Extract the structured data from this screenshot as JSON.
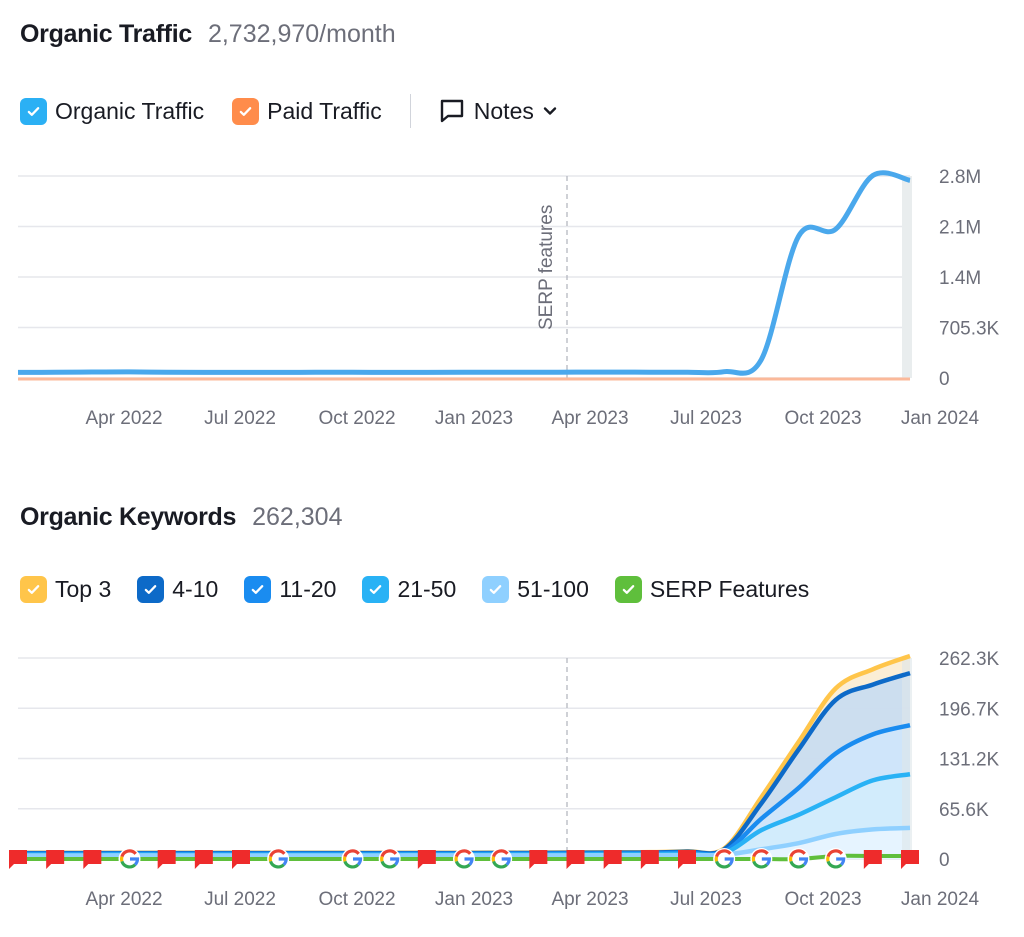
{
  "traffic": {
    "title": "Organic Traffic",
    "value": "2,732,970/month",
    "legend": [
      {
        "label": "Organic Traffic",
        "color": "#2bb0f4",
        "checked": true
      },
      {
        "label": "Paid Traffic",
        "color": "#ff8c4b",
        "checked": true
      }
    ],
    "notes_label": "Notes",
    "annotation": "SERP features"
  },
  "keywords": {
    "title": "Organic Keywords",
    "value": "262,304",
    "legend": [
      {
        "label": "Top 3",
        "color": "#ffc54a",
        "checked": true
      },
      {
        "label": "4-10",
        "color": "#0d6ac8",
        "checked": true
      },
      {
        "label": "11-20",
        "color": "#1a8cf0",
        "checked": true
      },
      {
        "label": "21-50",
        "color": "#29b2f5",
        "checked": true
      },
      {
        "label": "51-100",
        "color": "#8fd0ff",
        "checked": true
      },
      {
        "label": "SERP Features",
        "color": "#5fbf3c",
        "checked": true
      }
    ]
  },
  "chart_data": [
    {
      "type": "line",
      "title": "Organic Traffic",
      "x": [
        "Jan 2022",
        "Feb 2022",
        "Mar 2022",
        "Apr 2022",
        "May 2022",
        "Jun 2022",
        "Jul 2022",
        "Aug 2022",
        "Sep 2022",
        "Oct 2022",
        "Nov 2022",
        "Dec 2022",
        "Jan 2023",
        "Feb 2023",
        "Mar 2023",
        "Apr 2023",
        "May 2023",
        "Jun 2023",
        "Jul 2023",
        "Aug 2023",
        "Sep 2023",
        "Oct 2023",
        "Nov 2023",
        "Dec 2023"
      ],
      "x_tick_labels": [
        "Apr 2022",
        "Jul 2022",
        "Oct 2022",
        "Jan 2023",
        "Apr 2023",
        "Jul 2023",
        "Oct 2023",
        "Jan 2024"
      ],
      "y_tick_labels": [
        "0",
        "705.3K",
        "1.4M",
        "2.1M",
        "2.8M"
      ],
      "ylim": [
        0,
        2821200
      ],
      "grid": true,
      "annotations": [
        {
          "x": "Apr 2023",
          "label": "SERP features"
        }
      ],
      "series": [
        {
          "name": "Organic Traffic",
          "color": "#4aa8ec",
          "values": [
            50000,
            52000,
            55000,
            58000,
            52000,
            50000,
            51000,
            50000,
            52000,
            53000,
            50000,
            51000,
            52000,
            53000,
            52000,
            54000,
            54000,
            53000,
            52000,
            60000,
            230000,
            1950000,
            2050000,
            2800000,
            2732970
          ]
        },
        {
          "name": "Paid Traffic",
          "color": "#fbb99a",
          "values": [
            0,
            0,
            0,
            0,
            0,
            0,
            0,
            0,
            0,
            0,
            0,
            0,
            0,
            0,
            0,
            0,
            0,
            0,
            0,
            0,
            0,
            0,
            0,
            0,
            0
          ]
        }
      ]
    },
    {
      "type": "area",
      "title": "Organic Keywords",
      "x": [
        "Jan 2022",
        "Feb 2022",
        "Mar 2022",
        "Apr 2022",
        "May 2022",
        "Jun 2022",
        "Jul 2022",
        "Aug 2022",
        "Sep 2022",
        "Oct 2022",
        "Nov 2022",
        "Dec 2022",
        "Jan 2023",
        "Feb 2023",
        "Mar 2023",
        "Apr 2023",
        "May 2023",
        "Jun 2023",
        "Jul 2023",
        "Aug 2023",
        "Sep 2023",
        "Oct 2023",
        "Nov 2023",
        "Dec 2023"
      ],
      "x_tick_labels": [
        "Apr 2022",
        "Jul 2022",
        "Oct 2022",
        "Jan 2023",
        "Apr 2023",
        "Jul 2023",
        "Oct 2023",
        "Jan 2024"
      ],
      "y_tick_labels": [
        "0",
        "65.6K",
        "131.2K",
        "196.7K",
        "262.3K"
      ],
      "ylim": [
        0,
        262300
      ],
      "grid": true,
      "stacked": true,
      "series": [
        {
          "name": "51-100",
          "color": "#8fd0ff",
          "values": [
            2000,
            2000,
            2000,
            2100,
            2000,
            2000,
            2000,
            2000,
            2000,
            2000,
            2000,
            2100,
            2100,
            2100,
            2200,
            2200,
            2300,
            2300,
            2500,
            3000,
            10000,
            18000,
            30000,
            36000,
            38000
          ]
        },
        {
          "name": "21-50",
          "color": "#29b2f5",
          "values": [
            3000,
            3000,
            3000,
            3100,
            3000,
            3000,
            3000,
            3000,
            3000,
            3000,
            3000,
            3100,
            3100,
            3200,
            3200,
            3300,
            3400,
            3500,
            4000,
            5000,
            35000,
            55000,
            78000,
            100000,
            108000
          ]
        },
        {
          "name": "11-20",
          "color": "#1a8cf0",
          "values": [
            4000,
            4000,
            4000,
            4100,
            4000,
            4000,
            4000,
            4000,
            4000,
            4000,
            4000,
            4100,
            4100,
            4200,
            4300,
            4400,
            4500,
            4600,
            5500,
            7000,
            50000,
            90000,
            135000,
            160000,
            172000
          ]
        },
        {
          "name": "4-10",
          "color": "#0d6ac8",
          "values": [
            5000,
            5000,
            5000,
            5100,
            5000,
            5000,
            5000,
            5000,
            5000,
            5000,
            5000,
            5100,
            5100,
            5200,
            5300,
            5500,
            5700,
            5800,
            7000,
            10000,
            70000,
            140000,
            205000,
            225000,
            240000
          ]
        },
        {
          "name": "Top 3",
          "color": "#ffc54a",
          "values": [
            5500,
            5500,
            5500,
            5600,
            5500,
            5500,
            5500,
            5500,
            5500,
            5500,
            5500,
            5600,
            5600,
            5700,
            5800,
            6000,
            6200,
            6300,
            7500,
            11000,
            78000,
            150000,
            220000,
            245000,
            262304
          ]
        }
      ],
      "serp_features_markers": [
        "flag",
        "flag",
        "flag",
        "google",
        "flag",
        "flag",
        "flag",
        "google",
        "",
        "google",
        "google",
        "flag",
        "google",
        "google",
        "flag",
        "flag",
        "flag",
        "flag",
        "flag",
        "google",
        "google",
        "google",
        "google",
        "flag",
        "flag"
      ]
    }
  ]
}
